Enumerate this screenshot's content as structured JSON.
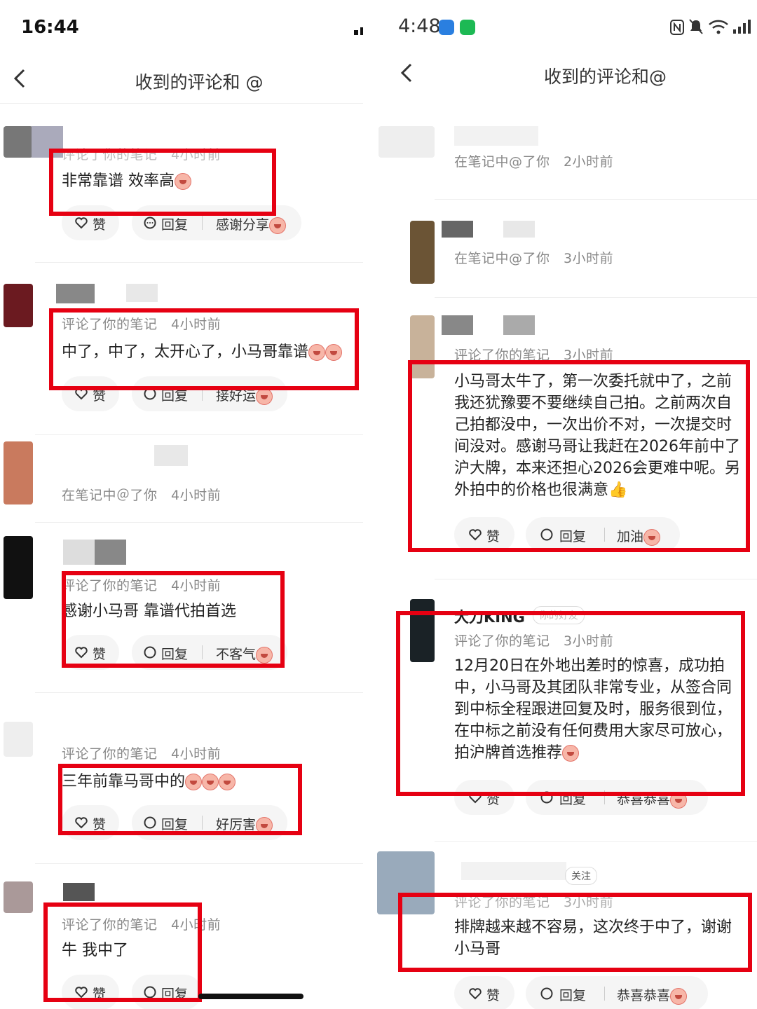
{
  "left": {
    "time": "16:44",
    "title": "收到的评论和 @",
    "items": [
      {
        "meta": "评论了你的笔记　4小时前",
        "comment": "非常靠谱 效率高",
        "like": "赞",
        "reply": "回复",
        "quick": "感谢分享"
      },
      {
        "meta": "评论了你的笔记　4小时前",
        "comment": "中了，中了，太开心了，小马哥靠谱",
        "like": "赞",
        "reply": "回复",
        "quick": "接好运"
      },
      {
        "meta": "在笔记中＠了你　4小时前"
      },
      {
        "meta": "评论了你的笔记　4小时前",
        "comment": "感谢小马哥 靠谱代拍首选",
        "like": "赞",
        "reply": "回复",
        "quick": "不客气"
      },
      {
        "meta": "评论了你的笔记　4小时前",
        "comment": "三年前靠马哥中的",
        "like": "赞",
        "reply": "回复",
        "quick": "好厉害"
      },
      {
        "meta": "评论了你的笔记　4小时前",
        "comment": "牛 我中了",
        "like": "赞",
        "reply": "回复"
      }
    ]
  },
  "right": {
    "time": "4:48",
    "title": "收到的评论和@",
    "items": [
      {
        "meta": "在笔记中@了你　2小时前"
      },
      {
        "meta": "在笔记中@了你　3小时前"
      },
      {
        "meta": "评论了你的笔记　3小时前",
        "comment": "小马哥太牛了，第一次委托就中了，之前我还犹豫要不要继续自己拍。之前两次自己拍都没中，一次出价不对，一次提交时间没对。感谢马哥让我赶在2026年前中了沪大牌，本来还担心2026会更难中呢。另外拍中的价格也很满意👍",
        "like": "赞",
        "reply": "回复",
        "quick": "加油"
      },
      {
        "name": "大刀KING",
        "tag": "你的好友",
        "meta": "评论了你的笔记　3小时前",
        "comment": "12月20日在外地出差时的惊喜，成功拍中，小马哥及其团队非常专业，从签合同到中标全程跟进回复及时，服务很到位，在中标之前没有任何费用大家尽可放心，拍沪牌首选推荐",
        "like": "赞",
        "reply": "回复",
        "quick": "恭喜恭喜"
      },
      {
        "tag": "关注",
        "meta": "评论了你的笔记　3小时前",
        "comment": "排牌越来越不容易，这次终于中了，谢谢小马哥",
        "like": "赞",
        "reply": "回复",
        "quick": "恭喜恭喜"
      }
    ]
  },
  "colors": {
    "highlight": "#e60012",
    "pill": "#f5f5f5",
    "meta": "#888888"
  },
  "icons": [
    "back-arrow-icon",
    "signal-icon",
    "heart-icon",
    "comment-icon",
    "emoji-icon",
    "wifi-icon",
    "mute-icon",
    "nfc-icon"
  ]
}
